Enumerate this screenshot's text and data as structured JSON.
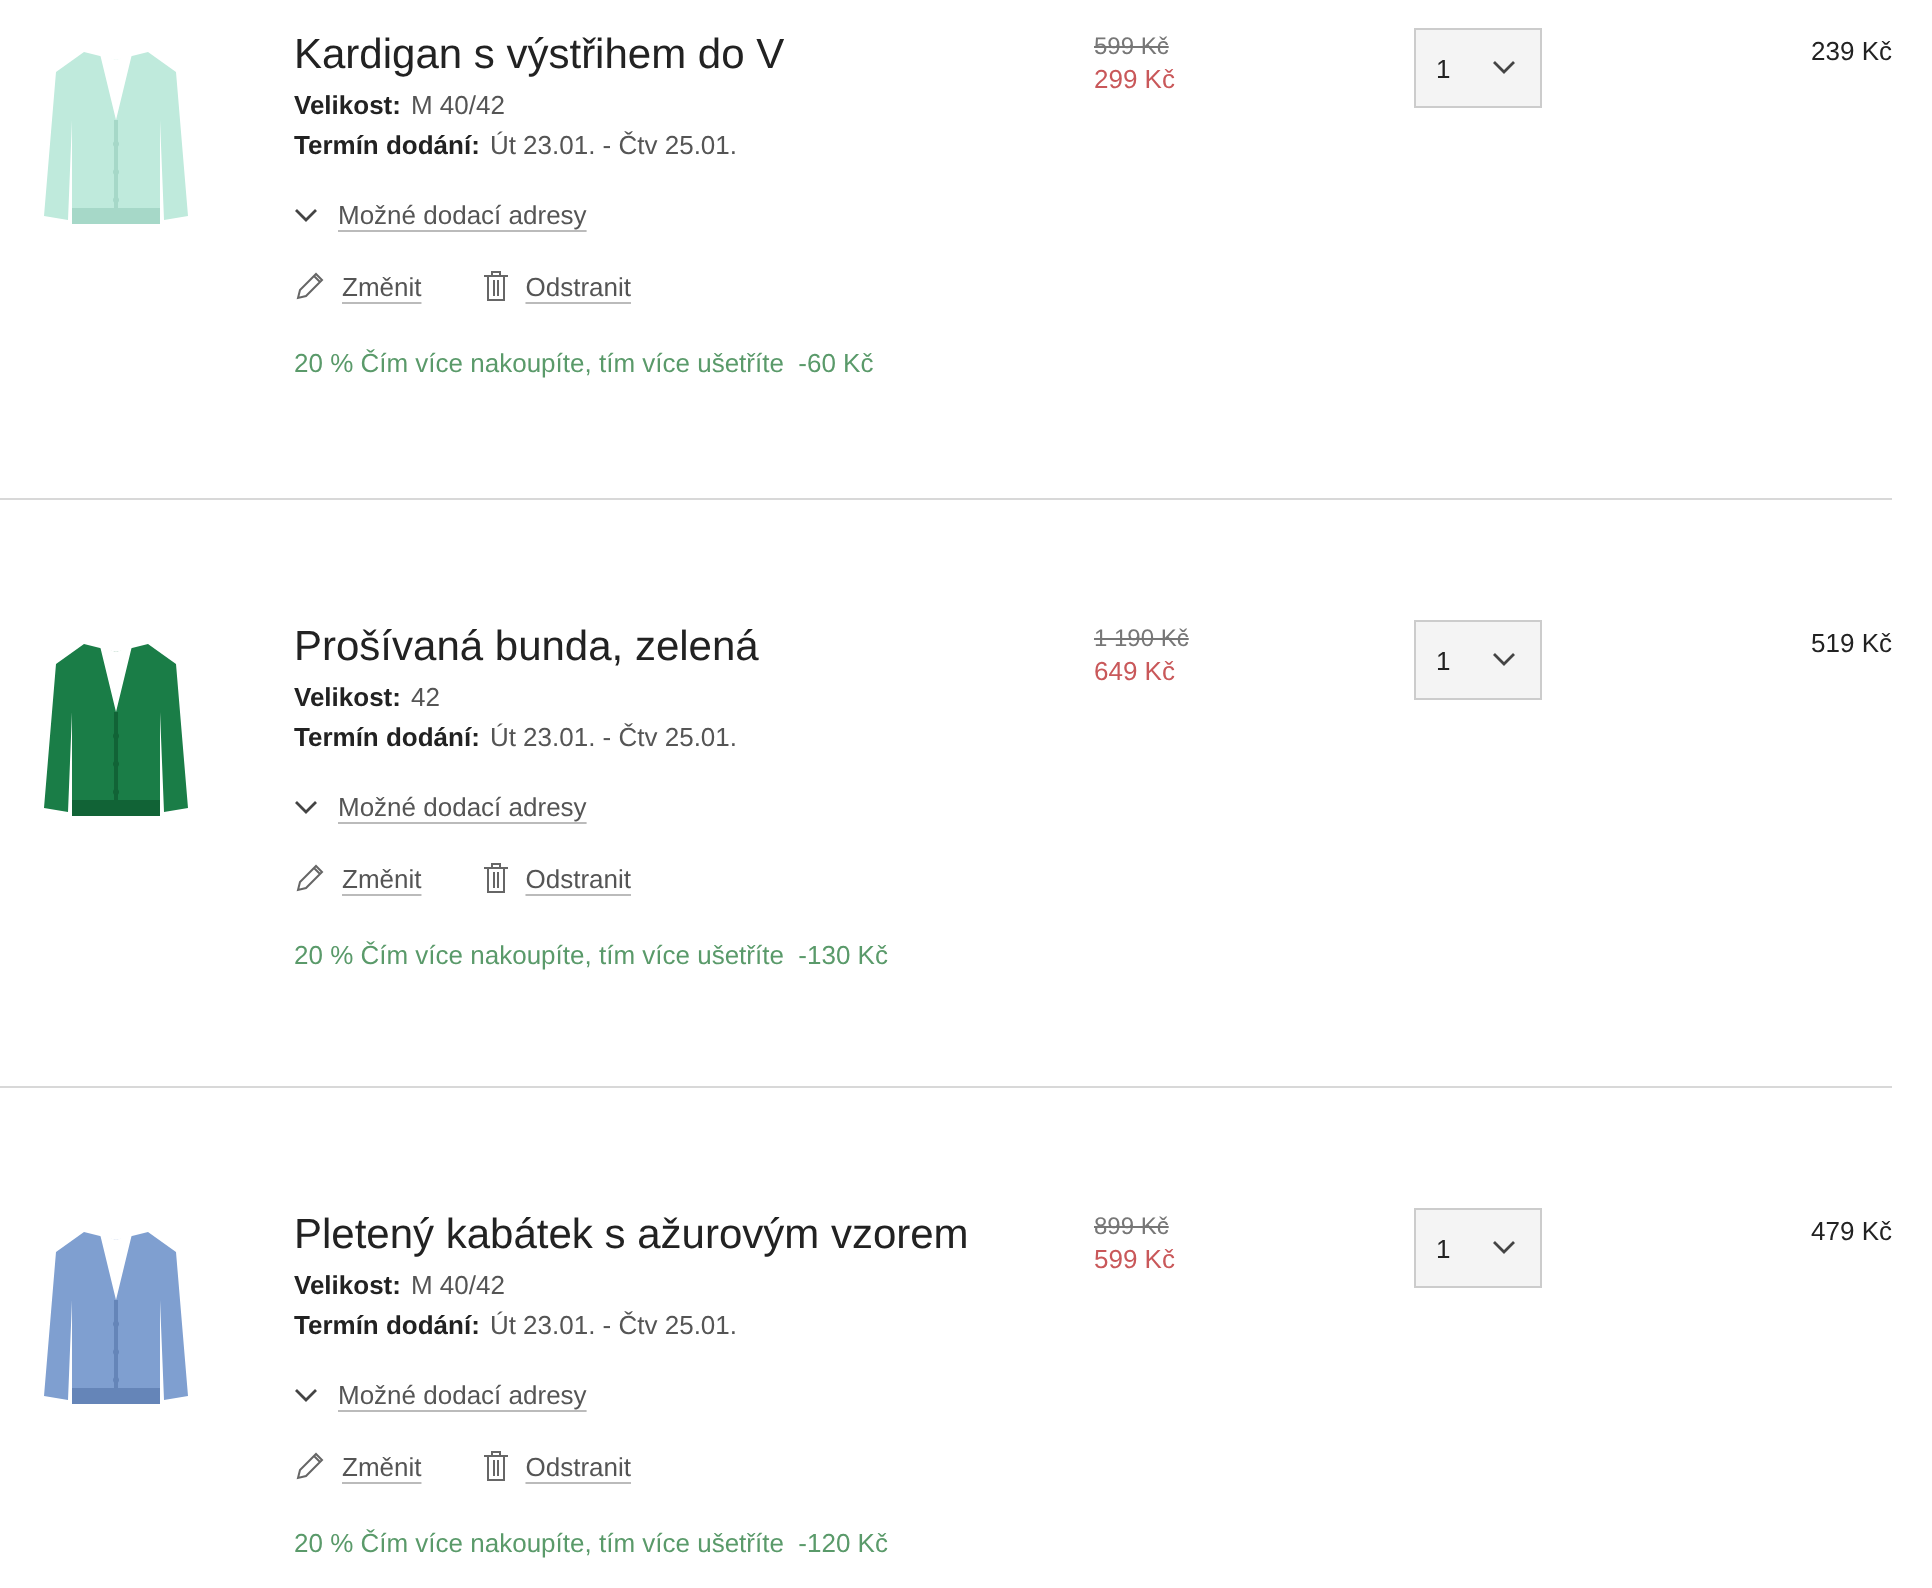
{
  "items": [
    {
      "title": "Kardigan s výstřihem do V",
      "size_label": "Velikost:",
      "size": "M 40/42",
      "delivery_label": "Termín dodání:",
      "delivery": "Út 23.01. - Čtv 25.01.",
      "addresses_link": "Možné dodací adresy",
      "addresses_expanded": false,
      "edit": "Změnit",
      "remove": "Odstranit",
      "discount": "20 % Čím více nakoupíte, tím více ušetříte  -60 Kč",
      "old_price": "599 Kč",
      "price": "299 Kč",
      "quantity": "1",
      "total": "239 Kč"
    },
    {
      "title": "Prošívaná bunda, zelená",
      "size_label": "Velikost:",
      "size": "42",
      "delivery_label": "Termín dodání:",
      "delivery": "Út 23.01. - Čtv 25.01.",
      "addresses_link": "Možné dodací adresy",
      "addresses_expanded": false,
      "edit": "Změnit",
      "remove": "Odstranit",
      "discount": "20 % Čím více nakoupíte, tím více ušetříte  -130 Kč",
      "old_price": "1 190 Kč",
      "price": "649 Kč",
      "quantity": "1",
      "total": "519 Kč"
    },
    {
      "title": "Pletený kabátek s ažurovým vzorem",
      "size_label": "Velikost:",
      "size": "M 40/42",
      "delivery_label": "Termín dodání:",
      "delivery": "Út 23.01. - Čtv 25.01.",
      "addresses_link": "Možné dodací adresy",
      "addresses_expanded": false,
      "edit": "Změnit",
      "remove": "Odstranit",
      "discount": "20 % Čím více nakoupíte, tím více ušetříte  -120 Kč",
      "old_price": "899 Kč",
      "price": "599 Kč",
      "quantity": "1",
      "total": "479 Kč"
    }
  ]
}
